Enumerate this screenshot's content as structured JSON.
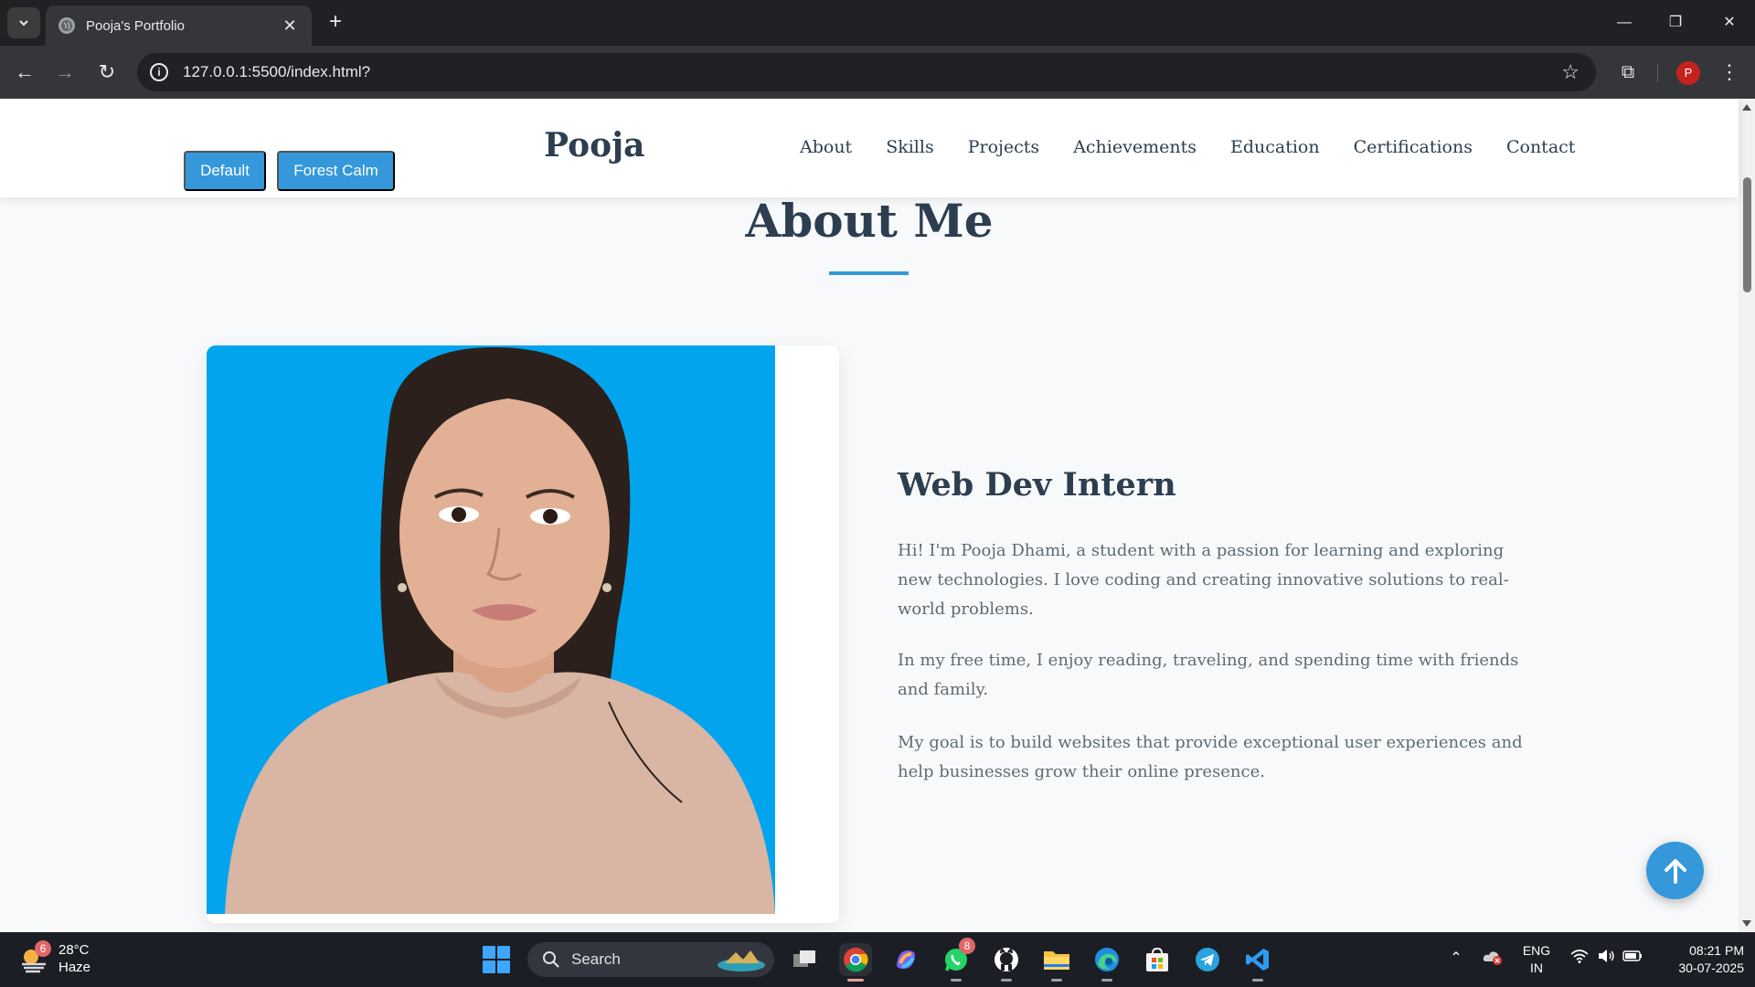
{
  "browser": {
    "tab_title": "Pooja's Portfolio",
    "url": "127.0.0.1:5500/index.html?",
    "profile_initial": "P"
  },
  "site": {
    "theme_buttons": [
      "Default",
      "Forest Calm"
    ],
    "logo": "Pooja",
    "nav": [
      "About",
      "Skills",
      "Projects",
      "Achievements",
      "Education",
      "Certifications",
      "Contact"
    ]
  },
  "about": {
    "title": "About Me",
    "role": "Web Dev Intern",
    "paragraphs": [
      "Hi! I'm Pooja Dhami, a student with a passion for learning and exploring new technologies. I love coding and creating innovative solutions to real-world problems.",
      "In my free time, I enjoy reading, traveling, and spending time with friends and family.",
      "My goal is to build websites that provide exceptional user experiences and help businesses grow their online presence."
    ]
  },
  "taskbar": {
    "weather_badge": "6",
    "temperature": "28°C",
    "condition": "Haze",
    "search_label": "Search",
    "whatsapp_badge": "8",
    "language_line1": "ENG",
    "language_line2": "IN",
    "time": "08:21 PM",
    "date": "30-07-2025"
  },
  "colors": {
    "accent": "#3498db",
    "heading": "#2c3e50",
    "body_text": "#5f6b73",
    "photo_background": "#03a4ee"
  }
}
